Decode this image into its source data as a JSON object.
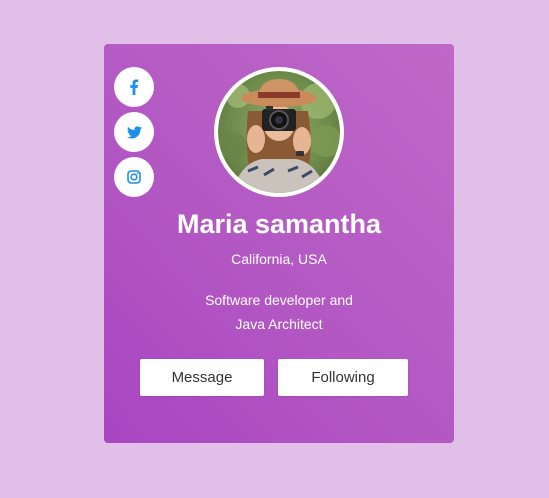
{
  "profile": {
    "name": "Maria samantha",
    "location": "California, USA",
    "bio_line1": "Software developer and",
    "bio_line2": "Java Architect"
  },
  "actions": {
    "message_label": "Message",
    "following_label": "Following"
  },
  "social": [
    {
      "icon": "facebook-icon"
    },
    {
      "icon": "twitter-icon"
    },
    {
      "icon": "instagram-icon"
    }
  ],
  "colors": {
    "background": "#e1bfe8",
    "card_gradient_start": "#bf68c9",
    "card_gradient_end": "#a945c2",
    "social_icon": "#1e8fe6"
  }
}
